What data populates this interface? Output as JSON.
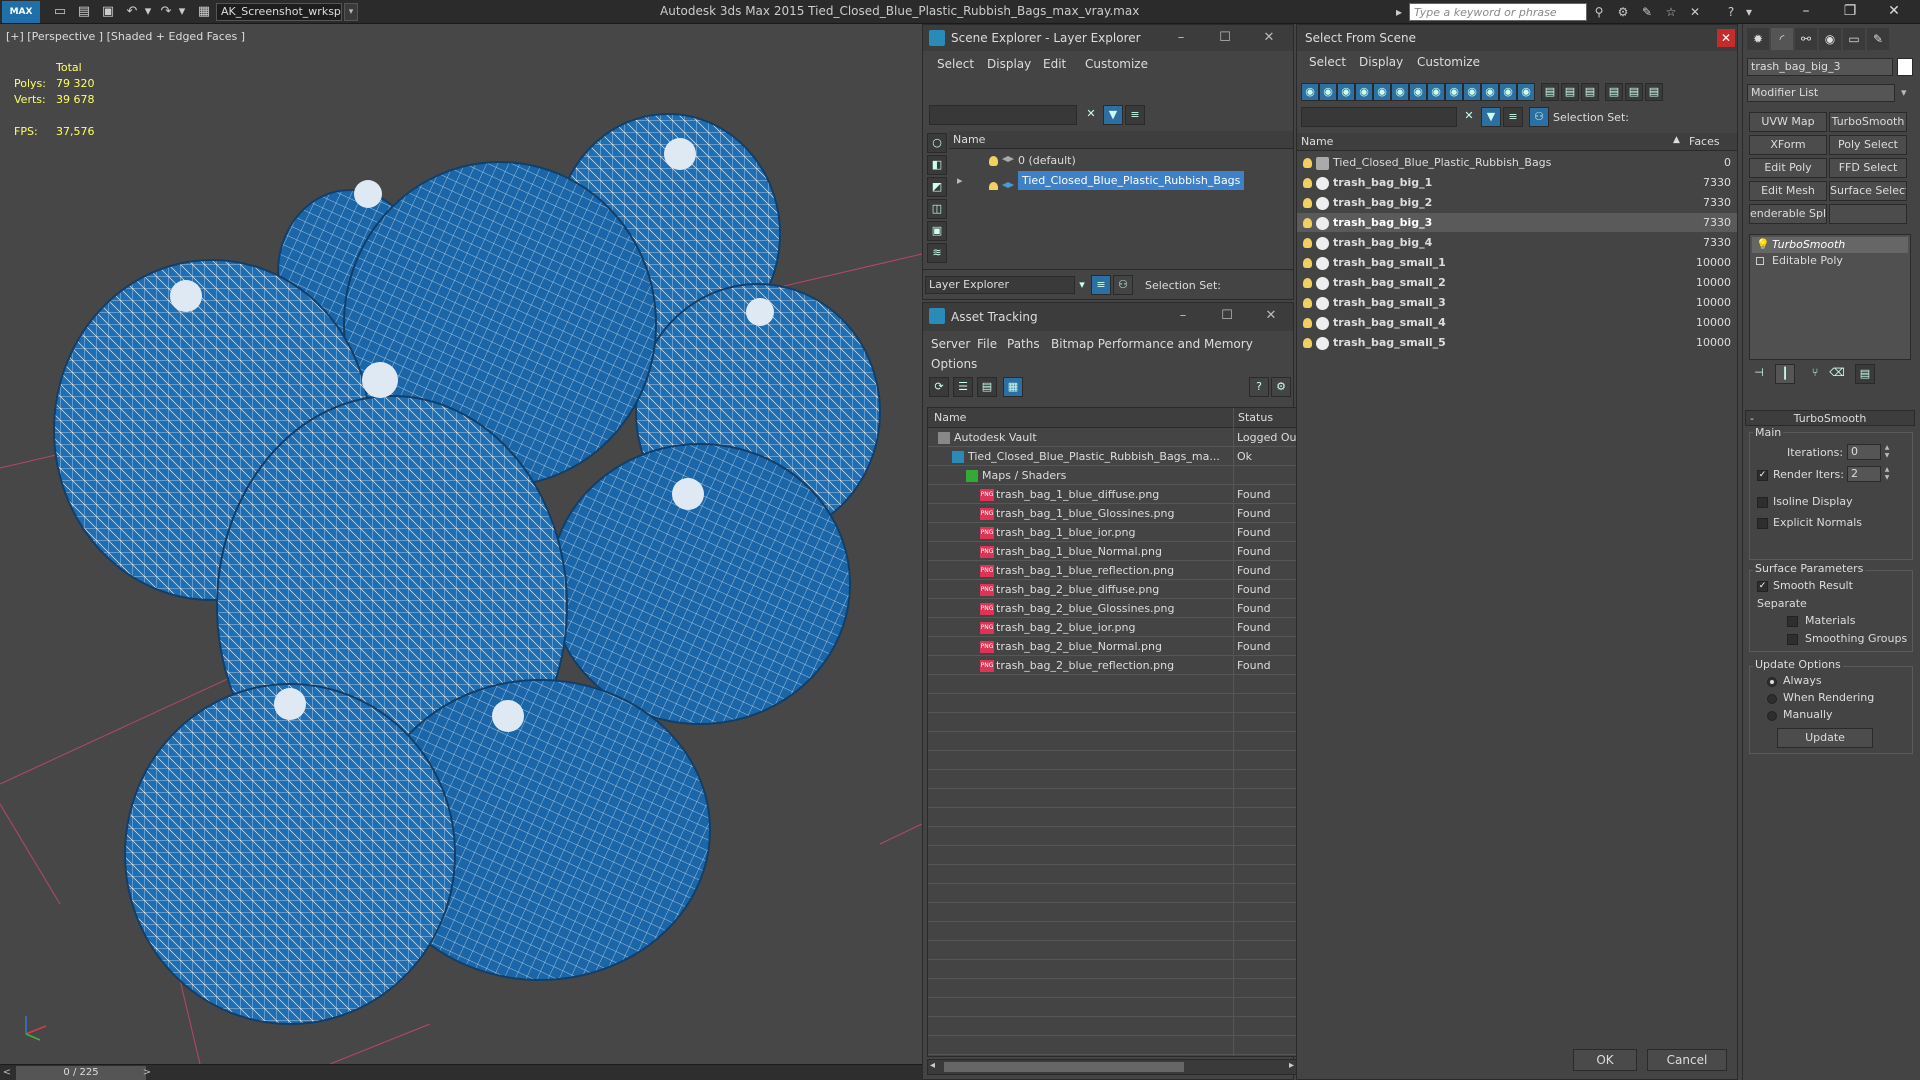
{
  "titlebar": {
    "logo_text": "MAX",
    "workspace": "AK_Screenshot_wrksp",
    "app_title": "Autodesk 3ds Max  2015    Tied_Closed_Blue_Plastic_Rubbish_Bags_max_vray.max",
    "search_placeholder": "Type a keyword or phrase"
  },
  "viewport": {
    "label": "[+] [Perspective ] [Shaded + Edged Faces ]",
    "stats_total": "Total",
    "polys_label": "Polys:",
    "polys_value": "79 320",
    "verts_label": "Verts:",
    "verts_value": "39 678",
    "fps_label": "FPS:",
    "fps_value": "37,576",
    "bag_color": "#1e6eb4",
    "wire_color": "#ffffff"
  },
  "timeline": {
    "frame": "0 / 225",
    "prev": "<",
    "next": ">"
  },
  "scene_explorer": {
    "title": "Scene Explorer - Layer Explorer",
    "menu": [
      "Select",
      "Display",
      "Edit",
      "Customize"
    ],
    "column_name": "Name",
    "layers": [
      {
        "name": "0 (default)",
        "selected": false
      },
      {
        "name": "Tied_Closed_Blue_Plastic_Rubbish_Bags",
        "selected": true
      }
    ],
    "bottom_dropdown": "Layer Explorer",
    "selection_set_label": "Selection Set:"
  },
  "asset_tracking": {
    "title": "Asset Tracking",
    "menu": [
      "Server",
      "File",
      "Paths",
      "Bitmap Performance and Memory",
      "Options"
    ],
    "col_name": "Name",
    "col_status": "Status",
    "rows": [
      {
        "name": "Autodesk Vault",
        "status": "Logged Ou",
        "indent": 1,
        "icon": "vault"
      },
      {
        "name": "Tied_Closed_Blue_Plastic_Rubbish_Bags_ma...",
        "status": "Ok",
        "indent": 2,
        "icon": "max"
      },
      {
        "name": "Maps / Shaders",
        "status": "",
        "indent": 3,
        "icon": "maps"
      },
      {
        "name": "trash_bag_1_blue_diffuse.png",
        "status": "Found",
        "indent": 4,
        "icon": "png"
      },
      {
        "name": "trash_bag_1_blue_Glossines.png",
        "status": "Found",
        "indent": 4,
        "icon": "png"
      },
      {
        "name": "trash_bag_1_blue_ior.png",
        "status": "Found",
        "indent": 4,
        "icon": "png"
      },
      {
        "name": "trash_bag_1_blue_Normal.png",
        "status": "Found",
        "indent": 4,
        "icon": "png"
      },
      {
        "name": "trash_bag_1_blue_reflection.png",
        "status": "Found",
        "indent": 4,
        "icon": "png"
      },
      {
        "name": "trash_bag_2_blue_diffuse.png",
        "status": "Found",
        "indent": 4,
        "icon": "png"
      },
      {
        "name": "trash_bag_2_blue_Glossines.png",
        "status": "Found",
        "indent": 4,
        "icon": "png"
      },
      {
        "name": "trash_bag_2_blue_ior.png",
        "status": "Found",
        "indent": 4,
        "icon": "png"
      },
      {
        "name": "trash_bag_2_blue_Normal.png",
        "status": "Found",
        "indent": 4,
        "icon": "png"
      },
      {
        "name": "trash_bag_2_blue_reflection.png",
        "status": "Found",
        "indent": 4,
        "icon": "png"
      }
    ],
    "png_badge": "PNG"
  },
  "select_from_scene": {
    "title": "Select From Scene",
    "menu": [
      "Select",
      "Display",
      "Customize"
    ],
    "selection_set_label": "Selection Set:",
    "col_name": "Name",
    "col_faces": "Faces",
    "objects": [
      {
        "name": "Tied_Closed_Blue_Plastic_Rubbish_Bags",
        "faces": "0",
        "bold": false,
        "selected": false,
        "group": true
      },
      {
        "name": "trash_bag_big_1",
        "faces": "7330",
        "bold": true,
        "selected": false,
        "group": false
      },
      {
        "name": "trash_bag_big_2",
        "faces": "7330",
        "bold": true,
        "selected": false,
        "group": false
      },
      {
        "name": "trash_bag_big_3",
        "faces": "7330",
        "bold": true,
        "selected": true,
        "group": false
      },
      {
        "name": "trash_bag_big_4",
        "faces": "7330",
        "bold": true,
        "selected": false,
        "group": false
      },
      {
        "name": "trash_bag_small_1",
        "faces": "10000",
        "bold": true,
        "selected": false,
        "group": false
      },
      {
        "name": "trash_bag_small_2",
        "faces": "10000",
        "bold": true,
        "selected": false,
        "group": false
      },
      {
        "name": "trash_bag_small_3",
        "faces": "10000",
        "bold": true,
        "selected": false,
        "group": false
      },
      {
        "name": "trash_bag_small_4",
        "faces": "10000",
        "bold": true,
        "selected": false,
        "group": false
      },
      {
        "name": "trash_bag_small_5",
        "faces": "10000",
        "bold": true,
        "selected": false,
        "group": false
      }
    ],
    "ok_label": "OK",
    "cancel_label": "Cancel"
  },
  "command_panel": {
    "object_name": "trash_bag_big_3",
    "modifier_list": "Modifier List",
    "modifier_buttons": [
      "UVW Map",
      "TurboSmooth",
      "XForm",
      "Poly Select",
      "Edit Poly",
      "FFD Select",
      "Edit Mesh",
      "Surface Select",
      "enderable Splir",
      ""
    ],
    "stack": [
      {
        "name": "TurboSmooth",
        "selected": true
      },
      {
        "name": "Editable Poly",
        "selected": false
      }
    ],
    "rollout_title": "TurboSmooth",
    "main_label": "Main",
    "iterations_label": "Iterations:",
    "iterations_value": "0",
    "render_iters_label": "Render Iters:",
    "render_iters_value": "2",
    "isoline_label": "Isoline Display",
    "explicit_normals_label": "Explicit Normals",
    "surface_params_label": "Surface Parameters",
    "smooth_result_label": "Smooth Result",
    "separate_label": "Separate",
    "materials_label": "Materials",
    "smoothing_groups_label": "Smoothing Groups",
    "update_options_label": "Update Options",
    "always_label": "Always",
    "when_rendering_label": "When Rendering",
    "manually_label": "Manually",
    "update_button": "Update"
  }
}
